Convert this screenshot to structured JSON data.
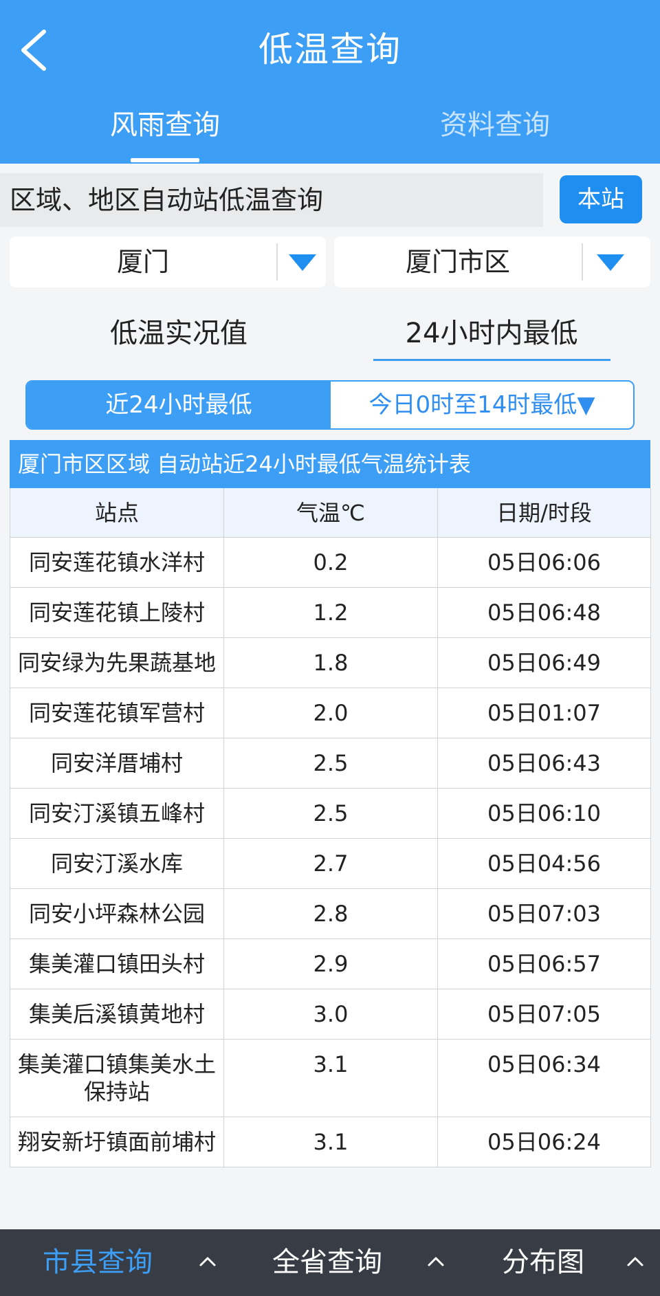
{
  "header": {
    "title": "低温查询",
    "tabs": [
      {
        "label": "风雨查询",
        "active": true
      },
      {
        "label": "资料查询",
        "active": false
      }
    ]
  },
  "query": {
    "label": "区域、地区自动站低温查询",
    "station_button": "本站"
  },
  "selects": {
    "city": "厦门",
    "district": "厦门市区"
  },
  "modes": {
    "left": "低温实况值",
    "right": "24小时内最低"
  },
  "segment": {
    "left": "近24小时最低",
    "right": "今日0时至14时最低▼"
  },
  "table": {
    "title": "厦门市区区域 自动站近24小时最低气温统计表",
    "headers": [
      "站点",
      "气温℃",
      "日期/时段"
    ],
    "rows": [
      {
        "station": "同安莲花镇水洋村",
        "temp": "0.2",
        "time": "05日06:06"
      },
      {
        "station": "同安莲花镇上陵村",
        "temp": "1.2",
        "time": "05日06:48"
      },
      {
        "station": "同安绿为先果蔬基地",
        "temp": "1.8",
        "time": "05日06:49"
      },
      {
        "station": "同安莲花镇军营村",
        "temp": "2.0",
        "time": "05日01:07"
      },
      {
        "station": "同安洋厝埔村",
        "temp": "2.5",
        "time": "05日06:43"
      },
      {
        "station": "同安汀溪镇五峰村",
        "temp": "2.5",
        "time": "05日06:10"
      },
      {
        "station": "同安汀溪水库",
        "temp": "2.7",
        "time": "05日04:56"
      },
      {
        "station": "同安小坪森林公园",
        "temp": "2.8",
        "time": "05日07:03"
      },
      {
        "station": "集美灌口镇田头村",
        "temp": "2.9",
        "time": "05日06:57"
      },
      {
        "station": "集美后溪镇黄地村",
        "temp": "3.0",
        "time": "05日07:05"
      },
      {
        "station": "集美灌口镇集美水土保持站",
        "temp": "3.1",
        "time": "05日06:34"
      },
      {
        "station": "翔安新圩镇面前埔村",
        "temp": "3.1",
        "time": "05日06:24"
      }
    ]
  },
  "bottom_nav": {
    "items": [
      {
        "label": "市县查询",
        "active": true
      },
      {
        "label": "全省查询",
        "active": false
      },
      {
        "label": "分布图",
        "active": false
      }
    ]
  },
  "colors": {
    "primary": "#3d9ef5",
    "button": "#1f8ef1",
    "nav_bg": "#383c44"
  },
  "icons": {
    "back": "back-arrow-icon",
    "dropdown": "caret-down-icon",
    "nav_expand": "chevron-up-icon"
  }
}
